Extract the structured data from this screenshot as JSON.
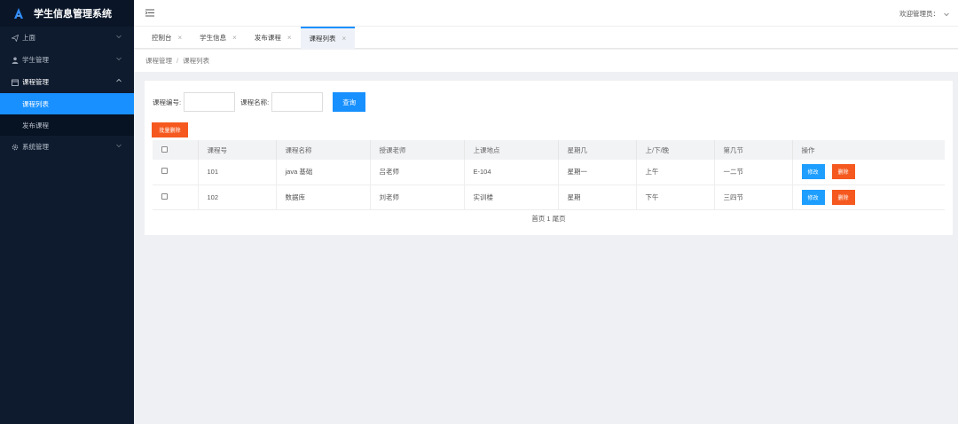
{
  "app": {
    "title": "学生信息管理系统"
  },
  "header": {
    "user_label": "欢迎管理员："
  },
  "sidebar": {
    "items": [
      {
        "label": "上面",
        "icon": "send-icon"
      },
      {
        "label": "学生管理",
        "icon": "user-icon"
      },
      {
        "label": "课程管理",
        "icon": "calendar-icon",
        "open": true,
        "children": [
          {
            "label": "课程列表",
            "active": true
          },
          {
            "label": "发布课程"
          }
        ]
      },
      {
        "label": "系统管理",
        "icon": "gear-icon"
      }
    ]
  },
  "tabs": [
    {
      "label": "控制台"
    },
    {
      "label": "学生信息"
    },
    {
      "label": "发布课程"
    },
    {
      "label": "课程列表",
      "active": true
    }
  ],
  "breadcrumb": {
    "parent": "课程管理",
    "separator": "/",
    "current": "课程列表"
  },
  "search": {
    "course_no_label": "课程编号:",
    "course_no_value": "",
    "course_name_label": "课程名称:",
    "course_name_value": "",
    "query_button": "查询"
  },
  "batch_delete_button": "批量删除",
  "table": {
    "headers": [
      "课程号",
      "课程名称",
      "授课老师",
      "上课地点",
      "星期几",
      "上/下/晚",
      "第几节",
      "操作"
    ],
    "rows": [
      [
        "101",
        "java 基础",
        "吕老师",
        "E-104",
        "星期一",
        "上午",
        "一二节"
      ],
      [
        "102",
        "数据库",
        "刘老师",
        "实训楼",
        "星期",
        "下午",
        "三四节"
      ]
    ],
    "edit_label": "修改",
    "delete_label": "删除"
  },
  "pager": {
    "text": "首页 1 尾页"
  },
  "colors": {
    "sidebar_bg": "#0e1b2e",
    "accent": "#1890ff",
    "danger": "#f5591f"
  }
}
